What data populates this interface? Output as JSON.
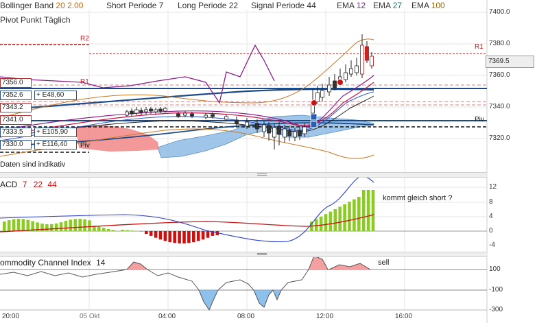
{
  "header": {
    "bollinger_label": "Bollinger Band",
    "bollinger_p1": "20",
    "bollinger_p2": "2.00",
    "short_label": "Short Periode",
    "short_value": "7",
    "long_label": "Long Periode",
    "long_value": "22",
    "signal_label": "Signal Periode",
    "signal_value": "44",
    "ema1_label": "EMA",
    "ema1_value": "12",
    "ema2_label": "EMA",
    "ema2_value": "27",
    "ema3_label": "EMA",
    "ema3_value": "100",
    "pivot_label": "Pivot Punkt  Täglich"
  },
  "price_axis": [
    "7400.0",
    "7380.0",
    "7360.0",
    "7340.0",
    "7320.0"
  ],
  "current_price": "7369.5",
  "levels": {
    "r2": "R2",
    "r1_right": "R1",
    "r1_left": "R1",
    "piv_left": "Piv",
    "piv_right": "Piv"
  },
  "price_tags": [
    {
      "price": "7356.0",
      "delta": ""
    },
    {
      "price": "7352.6",
      "delta": "+ E48,60"
    },
    {
      "price": "7343.2",
      "delta": ""
    },
    {
      "price": "7341.0",
      "delta": ""
    },
    {
      "price": "7333.5",
      "delta": "+ E105,90"
    },
    {
      "price": "7330.0",
      "delta": "+ E116,40"
    }
  ],
  "footnote": "Daten sind indikativ",
  "macd": {
    "label": "ACD",
    "p1": "7",
    "p2": "22",
    "p3": "44",
    "axis": [
      "12",
      "8",
      "4",
      "0",
      "-4"
    ],
    "comment": "kommt gleich short ?"
  },
  "cci": {
    "label": "ommodity Channel Index",
    "period": "14",
    "axis": [
      "100",
      "-100",
      "-300"
    ],
    "comment": "sell"
  },
  "time_axis": [
    "20:00",
    "05 Okt",
    "04:00",
    "08:00",
    "12:00",
    "16:00"
  ],
  "colors": {
    "bull": "#8ccc22",
    "bear": "#cc1111",
    "cloud": "#7fb3e0",
    "red_cloud": "#f08080",
    "blue_line": "#1a4a8a",
    "purple": "#8b1a8b"
  }
}
